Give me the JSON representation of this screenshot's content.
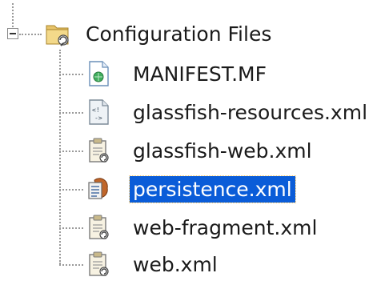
{
  "tree": {
    "root": {
      "label": "Configuration Files",
      "icon": "folder-config-icon",
      "expanded": true
    },
    "items": [
      {
        "label": "MANIFEST.MF",
        "icon": "manifest-file-icon",
        "selected": false
      },
      {
        "label": "glassfish-resources.xml",
        "icon": "xml-file-icon",
        "selected": false
      },
      {
        "label": "glassfish-web.xml",
        "icon": "descriptor-file-icon",
        "selected": false
      },
      {
        "label": "persistence.xml",
        "icon": "persistence-file-icon",
        "selected": true
      },
      {
        "label": "web-fragment.xml",
        "icon": "descriptor-file-icon",
        "selected": false
      },
      {
        "label": "web.xml",
        "icon": "descriptor-file-icon",
        "selected": false
      }
    ],
    "colors": {
      "selection": "#0a5cd8",
      "text": "#1a1a1a"
    }
  }
}
